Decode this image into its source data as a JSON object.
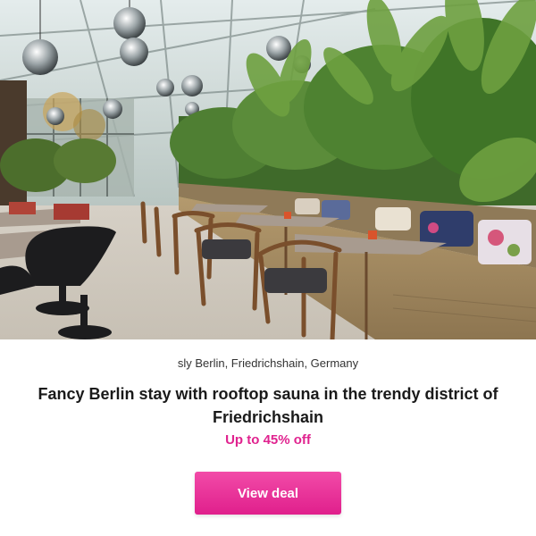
{
  "hero_image": {
    "alt": "Restaurant interior in a glass conservatory with tropical plants, wooden chairs, and cushioned bench seating",
    "icon": "photo"
  },
  "deal": {
    "location": "sly Berlin, Friedrichshain, Germany",
    "title": "Fancy Berlin stay with rooftop sauna in the trendy district of Friedrichshain",
    "discount": "Up to 45% off",
    "cta_label": "View deal"
  },
  "colors": {
    "accent": "#e0238f",
    "discount_text": "#e0238f",
    "button_bg": "#e82795",
    "title_text": "#1a1a1a"
  }
}
